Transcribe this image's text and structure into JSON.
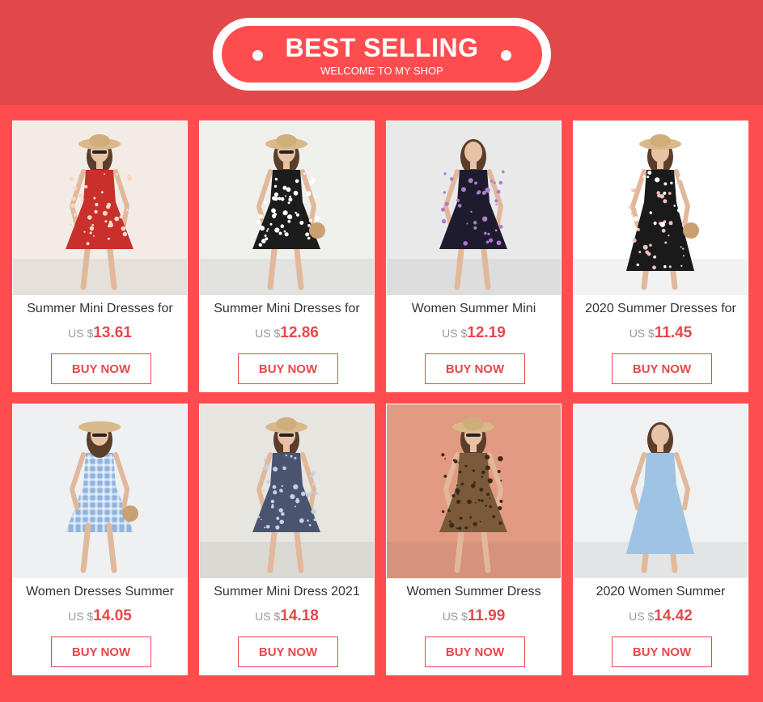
{
  "banner": {
    "title": "BEST SELLING",
    "subtitle": "WELCOME TO MY SHOP"
  },
  "colors": {
    "background": "#ff4d4f",
    "top_band": "#e2474a",
    "accent": "#e8474a",
    "card": "#ffffff"
  },
  "products": [
    {
      "title": "Summer Mini Dresses for",
      "currency": "US $",
      "price": "13.61",
      "button": "BUY NOW",
      "dress_color": "#c9302c",
      "bg_color": "#f3ece6",
      "pattern": "floral-red"
    },
    {
      "title": "Summer Mini Dresses for",
      "currency": "US $",
      "price": "12.86",
      "button": "BUY NOW",
      "dress_color": "#1c1c1c",
      "bg_color": "#efefec",
      "pattern": "dots-black"
    },
    {
      "title": "Women Summer Mini",
      "currency": "US $",
      "price": "12.19",
      "button": "BUY NOW",
      "dress_color": "#1e1b2e",
      "bg_color": "#e9e9e9",
      "pattern": "floral-purple"
    },
    {
      "title": "2020 Summer Dresses for",
      "currency": "US $",
      "price": "11.45",
      "button": "BUY NOW",
      "dress_color": "#1a1a1a",
      "bg_color": "#ffffff",
      "pattern": "floral-black"
    },
    {
      "title": "Women Dresses Summer",
      "currency": "US $",
      "price": "14.05",
      "button": "BUY NOW",
      "dress_color": "#8fb4e0",
      "bg_color": "#eef0f2",
      "pattern": "gingham-blue"
    },
    {
      "title": "Summer Mini Dress 2021",
      "currency": "US $",
      "price": "14.18",
      "button": "BUY NOW",
      "dress_color": "#4a5470",
      "bg_color": "#e7e5e0",
      "pattern": "print-navy"
    },
    {
      "title": "Women Summer Dress",
      "currency": "US $",
      "price": "11.99",
      "button": "BUY NOW",
      "dress_color": "#7a5a3a",
      "bg_color": "#e39a82",
      "pattern": "leopard"
    },
    {
      "title": "2020 Women Summer",
      "currency": "US $",
      "price": "14.42",
      "button": "BUY NOW",
      "dress_color": "#9fc3e2",
      "bg_color": "#eff1f2",
      "pattern": "solid-lightblue"
    }
  ]
}
